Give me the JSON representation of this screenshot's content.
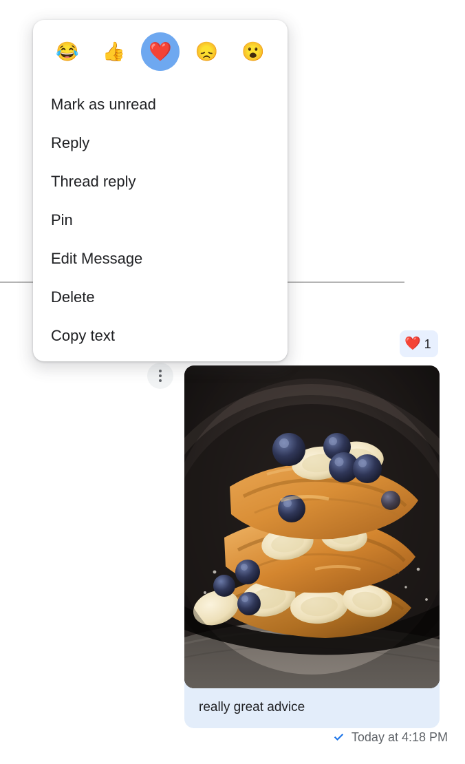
{
  "message": {
    "text": "really great advice",
    "timestamp": "Today at 4:18 PM",
    "status_icon": "sent-check-icon",
    "image_alt": "french-toast-with-blueberries-and-bananas",
    "bubble_color": "#e3edfa"
  },
  "reaction_badge": {
    "emoji": "❤️",
    "count": "1",
    "background": "#e8f0fe"
  },
  "options_button": {
    "icon": "more-vert-icon"
  },
  "context_menu": {
    "reactions": [
      {
        "name": "reaction-laugh",
        "emoji": "😂",
        "selected": false
      },
      {
        "name": "reaction-thumbs-up",
        "emoji": "👍",
        "selected": false
      },
      {
        "name": "reaction-heart",
        "emoji": "❤️",
        "selected": true
      },
      {
        "name": "reaction-sad",
        "emoji": "😞",
        "selected": false
      },
      {
        "name": "reaction-surprised",
        "emoji": "😮",
        "selected": false
      }
    ],
    "selected_color": "#6ea8f0",
    "items": [
      {
        "name": "menu-item-mark-as-unread",
        "label": "Mark as unread"
      },
      {
        "name": "menu-item-reply",
        "label": "Reply"
      },
      {
        "name": "menu-item-thread-reply",
        "label": "Thread reply"
      },
      {
        "name": "menu-item-pin",
        "label": "Pin"
      },
      {
        "name": "menu-item-edit-message",
        "label": "Edit Message"
      },
      {
        "name": "menu-item-delete",
        "label": "Delete"
      },
      {
        "name": "menu-item-copy-text",
        "label": "Copy text"
      }
    ]
  },
  "colors": {
    "accent": "#1a73e8",
    "divider": "#b4b4b4",
    "meta_text": "#5f6368"
  }
}
